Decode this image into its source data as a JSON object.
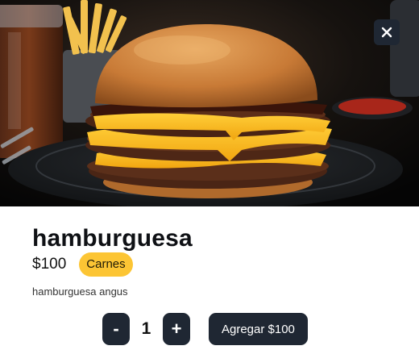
{
  "product": {
    "image_alt": "hamburguesa",
    "title": "hamburguesa",
    "price": "$100",
    "category": "Carnes",
    "description": "hamburguesa angus"
  },
  "quantity": {
    "decrement_label": "-",
    "value": "1",
    "increment_label": "+"
  },
  "add_to_cart": {
    "label": "Agregar $100"
  },
  "close": {
    "icon": "close-icon"
  },
  "colors": {
    "button_bg": "#1f2733",
    "badge_bg": "#fcc534",
    "text": "#0f1115"
  }
}
